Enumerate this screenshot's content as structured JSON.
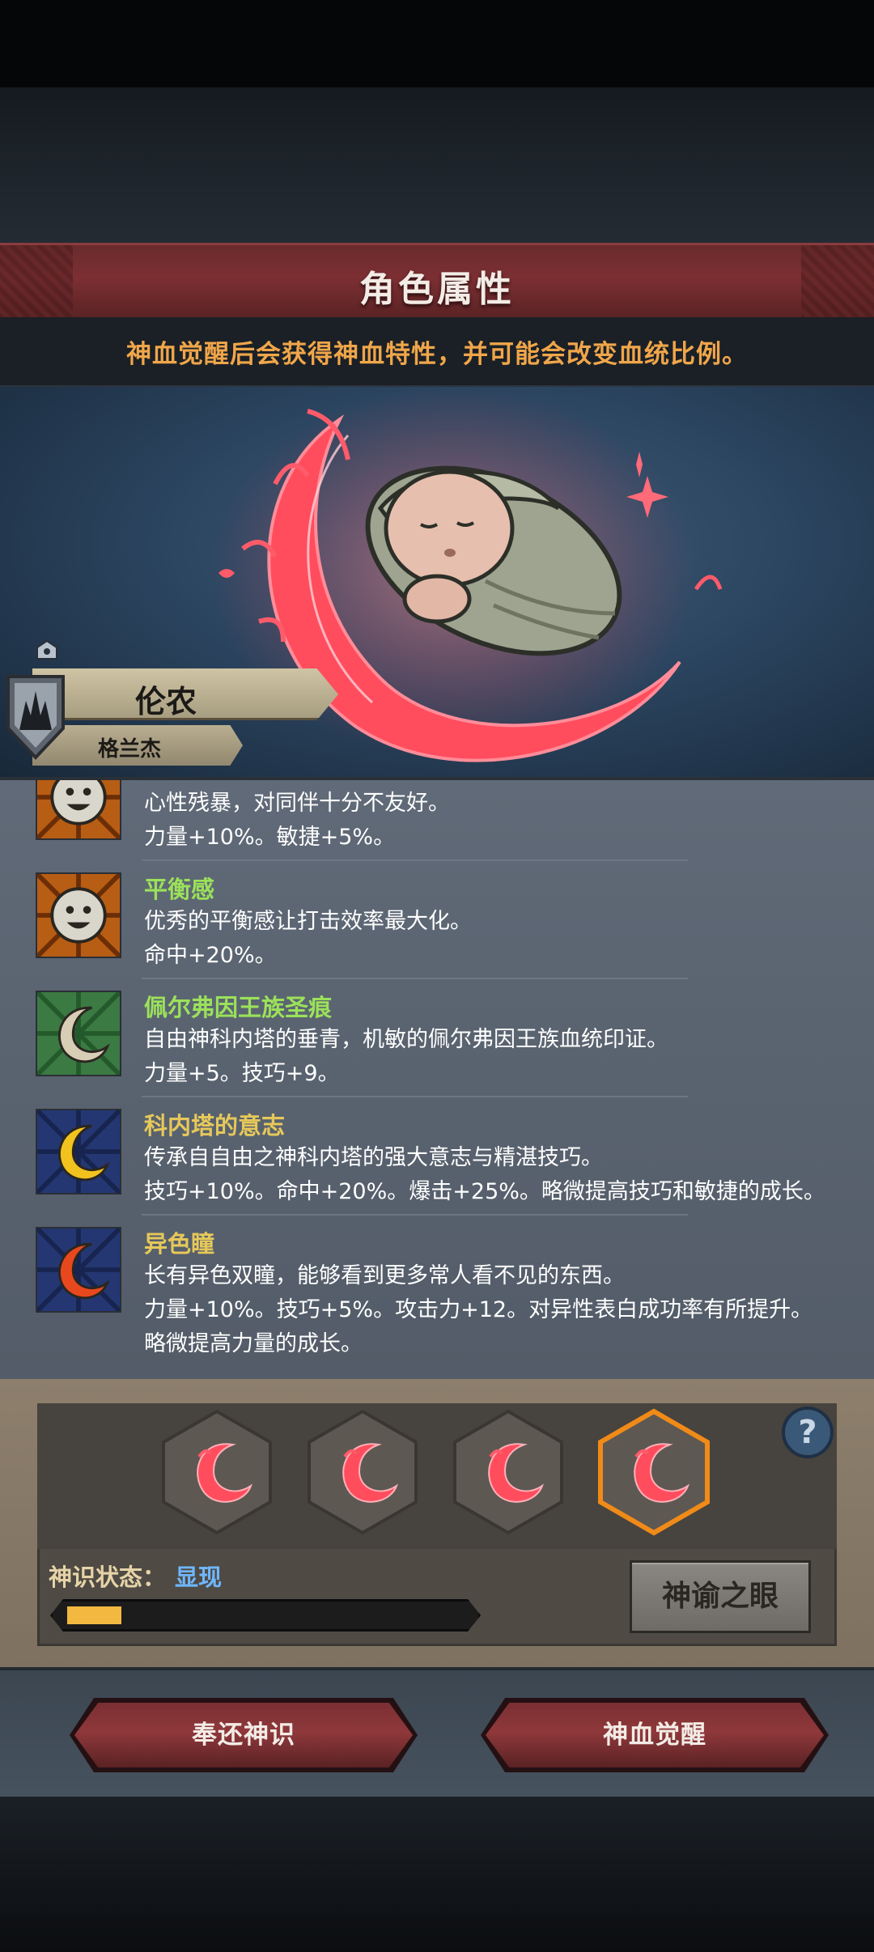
{
  "header": {
    "title": "角色属性"
  },
  "hint": "神血觉醒后会获得神血特性，并可能会改变血统比例。",
  "character": {
    "name": "伦农",
    "origin": "格兰杰"
  },
  "traits": [
    {
      "name": "",
      "desc1": "心性残暴，对同伴十分不友好。",
      "desc2": "力量+10%。敏捷+5%。",
      "icon": "smiley-sun-icon",
      "color": "#c46a1c"
    },
    {
      "name": "平衡感",
      "desc1": "优秀的平衡感让打击效率最大化。",
      "desc2": "命中+20%。",
      "icon": "smiley-sun-icon",
      "color": "#c46a1c"
    },
    {
      "name": "佩尔弗因王族圣痕",
      "desc1": "自由神科内塔的垂青，机敏的佩尔弗因王族血统印证。",
      "desc2": "力量+5。技巧+9。",
      "icon": "white-crescent-icon",
      "color": "#3d7a43"
    },
    {
      "name": "科内塔的意志",
      "desc1": "传承自自由之神科内塔的强大意志与精湛技巧。",
      "desc2": "技巧+10%。命中+20%。爆击+25%。略微提高技巧和敏捷的成长。",
      "icon": "gold-crescent-icon",
      "color": "#2c3f7a"
    },
    {
      "name": "异色瞳",
      "desc1": "长有异色双瞳，能够看到更多常人看不见的东西。",
      "desc2": "力量+10%。技巧+5%。攻击力+12。对异性表白成功率有所提升。",
      "desc3": "略微提高力量的成长。",
      "icon": "red-crescent-icon",
      "color": "#2c3f7a"
    }
  ],
  "panel": {
    "status_label": "神识状态：",
    "status_value": "显现",
    "progress": 0.14,
    "oracle_button": "神谕之眼",
    "help": "?"
  },
  "actions": {
    "return_label": "奉还神识",
    "awaken_label": "神血觉醒"
  }
}
